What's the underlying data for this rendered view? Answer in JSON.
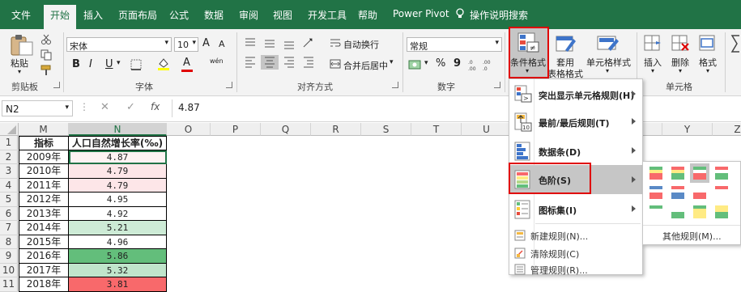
{
  "tabs": [
    {
      "label": "文件",
      "active": false
    },
    {
      "label": "开始",
      "active": true
    },
    {
      "label": "插入",
      "active": false
    },
    {
      "label": "页面布局",
      "active": false
    },
    {
      "label": "公式",
      "active": false
    },
    {
      "label": "数据",
      "active": false
    },
    {
      "label": "审阅",
      "active": false
    },
    {
      "label": "视图",
      "active": false
    },
    {
      "label": "开发工具",
      "active": false
    },
    {
      "label": "帮助",
      "active": false
    },
    {
      "label": "Power Pivot",
      "active": false
    }
  ],
  "tell_me": "操作说明搜索",
  "ribbon": {
    "clipboard": {
      "paste_label": "粘贴",
      "group_label": "剪贴板"
    },
    "font": {
      "font_name": "宋体",
      "font_size": "10",
      "group_label": "字体",
      "bold": "B",
      "italic": "I",
      "underline": "U",
      "grow": "A",
      "shrink": "A",
      "font_color_glyph": "A",
      "phonetic": "wén"
    },
    "alignment": {
      "wrap_label": "自动换行",
      "merge_label": "合并后居中",
      "group_label": "对齐方式"
    },
    "number": {
      "format": "常规",
      "group_label": "数字",
      "percent": "%",
      "comma": "9"
    },
    "styles": {
      "cond_format": "条件格式",
      "table_format_1": "套用",
      "table_format_2": "表格格式",
      "cell_styles": "单元格样式"
    },
    "cells": {
      "insert": "插入",
      "delete": "删除",
      "format": "格式",
      "group_label": "单元格"
    }
  },
  "formula_bar": {
    "name_box": "N2",
    "fx": "fx",
    "value": "4.87"
  },
  "columns": [
    "M",
    "N",
    "O",
    "P",
    "Q",
    "R",
    "S",
    "T",
    "U",
    "V",
    "W",
    "X",
    "Y",
    "Z"
  ],
  "rows": [
    "1",
    "2",
    "3",
    "4",
    "5",
    "6",
    "7",
    "8",
    "9",
    "10",
    "11"
  ],
  "table": {
    "headers": [
      "指标",
      "人口自然增长率(‰)"
    ],
    "data": [
      {
        "year": "2009年",
        "value": "4.87",
        "color": "#fef2f2"
      },
      {
        "year": "2010年",
        "value": "4.79",
        "color": "#fde6e8"
      },
      {
        "year": "2011年",
        "value": "4.79",
        "color": "#fde6e8"
      },
      {
        "year": "2012年",
        "value": "4.95",
        "color": "#ffffff"
      },
      {
        "year": "2013年",
        "value": "4.92",
        "color": "#ffffff"
      },
      {
        "year": "2014年",
        "value": "5.21",
        "color": "#cdebd6"
      },
      {
        "year": "2015年",
        "value": "4.96",
        "color": "#ffffff"
      },
      {
        "year": "2016年",
        "value": "5.86",
        "color": "#63be7b"
      },
      {
        "year": "2017年",
        "value": "5.32",
        "color": "#c0e5cb"
      },
      {
        "year": "2018年",
        "value": "3.81",
        "color": "#f8696b"
      }
    ]
  },
  "menu": {
    "items": [
      {
        "label": "突出显示单元格规则(H)",
        "icon": "highlight-rules-icon"
      },
      {
        "label": "最前/最后规则(T)",
        "icon": "top-bottom-icon"
      },
      {
        "label": "数据条(D)",
        "icon": "data-bars-icon"
      },
      {
        "label": "色阶(S)",
        "icon": "color-scales-icon",
        "highlighted": true
      },
      {
        "label": "图标集(I)",
        "icon": "icon-sets-icon"
      }
    ],
    "small_items": [
      {
        "label": "新建规则(N)..."
      },
      {
        "label": "清除规则(C)"
      },
      {
        "label": "管理规则(R)..."
      }
    ]
  },
  "submenu": {
    "more_rules": "其他规则(M)...",
    "swatches": [
      [
        "#63be7b",
        "#ffeb84",
        "#f8696b"
      ],
      [
        "#f8696b",
        "#ffeb84",
        "#63be7b"
      ],
      [
        "#63be7b",
        "#ffffff",
        "#f8696b"
      ],
      [
        "#f8696b",
        "#ffffff",
        "#63be7b"
      ],
      [
        "#5a8ac6",
        "#ffffff",
        "#f8696b"
      ],
      [
        "#f8696b",
        "#ffffff",
        "#5a8ac6"
      ],
      [
        "#ffffff",
        "#ffffff",
        "#f8696b"
      ],
      [
        "#f8696b",
        "#ffffff",
        "#ffffff"
      ],
      [
        "#63be7b",
        "#ffffff",
        "#ffffff"
      ],
      [
        "#ffffff",
        "#ffffff",
        "#63be7b"
      ],
      [
        "#63be7b",
        "#ffeb84",
        "#ffeb84"
      ],
      [
        "#ffeb84",
        "#ffeb84",
        "#63be7b"
      ]
    ]
  },
  "colors": {
    "excel_green": "#217346",
    "highlight_border": "#e00000",
    "menu_hover": "#c6c6c6"
  }
}
